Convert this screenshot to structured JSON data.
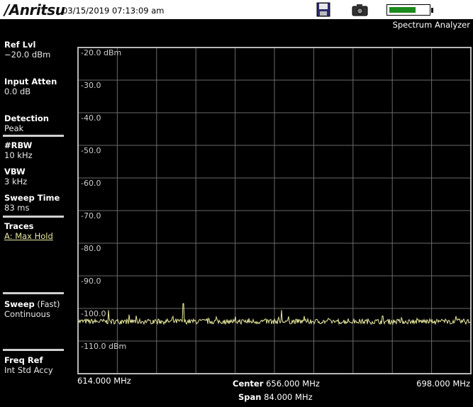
{
  "header": {
    "logo": "/Anritsu",
    "datetime": "03/15/2019 07:13:09 am",
    "mode": "Spectrum Analyzer",
    "battery_level": 0.68
  },
  "left_panel": {
    "ref_lvl": {
      "label": "Ref Lvl",
      "value": "−20.0 dBm"
    },
    "input_atten": {
      "label": "Input Atten",
      "value": "0.0 dB"
    },
    "detection": {
      "label": "Detection",
      "value": "Peak"
    },
    "rbw": {
      "label": "#RBW",
      "value": "10 kHz"
    },
    "vbw": {
      "label": "VBW",
      "value": "3 kHz"
    },
    "sweep_time": {
      "label": "Sweep Time",
      "value": "83 ms"
    },
    "traces": {
      "label": "Traces",
      "value": "A: Max Hold"
    },
    "sweep": {
      "label": "Sweep",
      "label_suffix": "(Fast)",
      "value": "Continuous"
    },
    "freq_ref": {
      "label": "Freq Ref",
      "value": "Int Std Accy"
    }
  },
  "plot": {
    "y_labels": [
      "-20.0 dBm",
      "-30.0",
      "-40.0",
      "-50.0",
      "-60.0",
      "-70.0",
      "-80.0",
      "-90.0",
      "-100.0",
      "-110.0 dBm"
    ],
    "start_freq": "614.000 MHz",
    "stop_freq": "698.000 MHz",
    "center_label": "Center",
    "center_value": "656.000 MHz",
    "span_label": "Span",
    "span_value": "84.000 MHz",
    "colors": {
      "trace": "#e8e8a0",
      "grid": "#6a6a6a",
      "baseline": "#b040b0"
    }
  },
  "chart_data": {
    "type": "line",
    "ylim": [
      -120,
      -20
    ],
    "xlim": [
      614,
      698
    ],
    "noise_floor_dbm": -104,
    "spikes": [
      {
        "x": 620.5,
        "y": -100.5
      },
      {
        "x": 636.5,
        "y": -98.5
      },
      {
        "x": 657.5,
        "y": -100.5
      }
    ]
  }
}
